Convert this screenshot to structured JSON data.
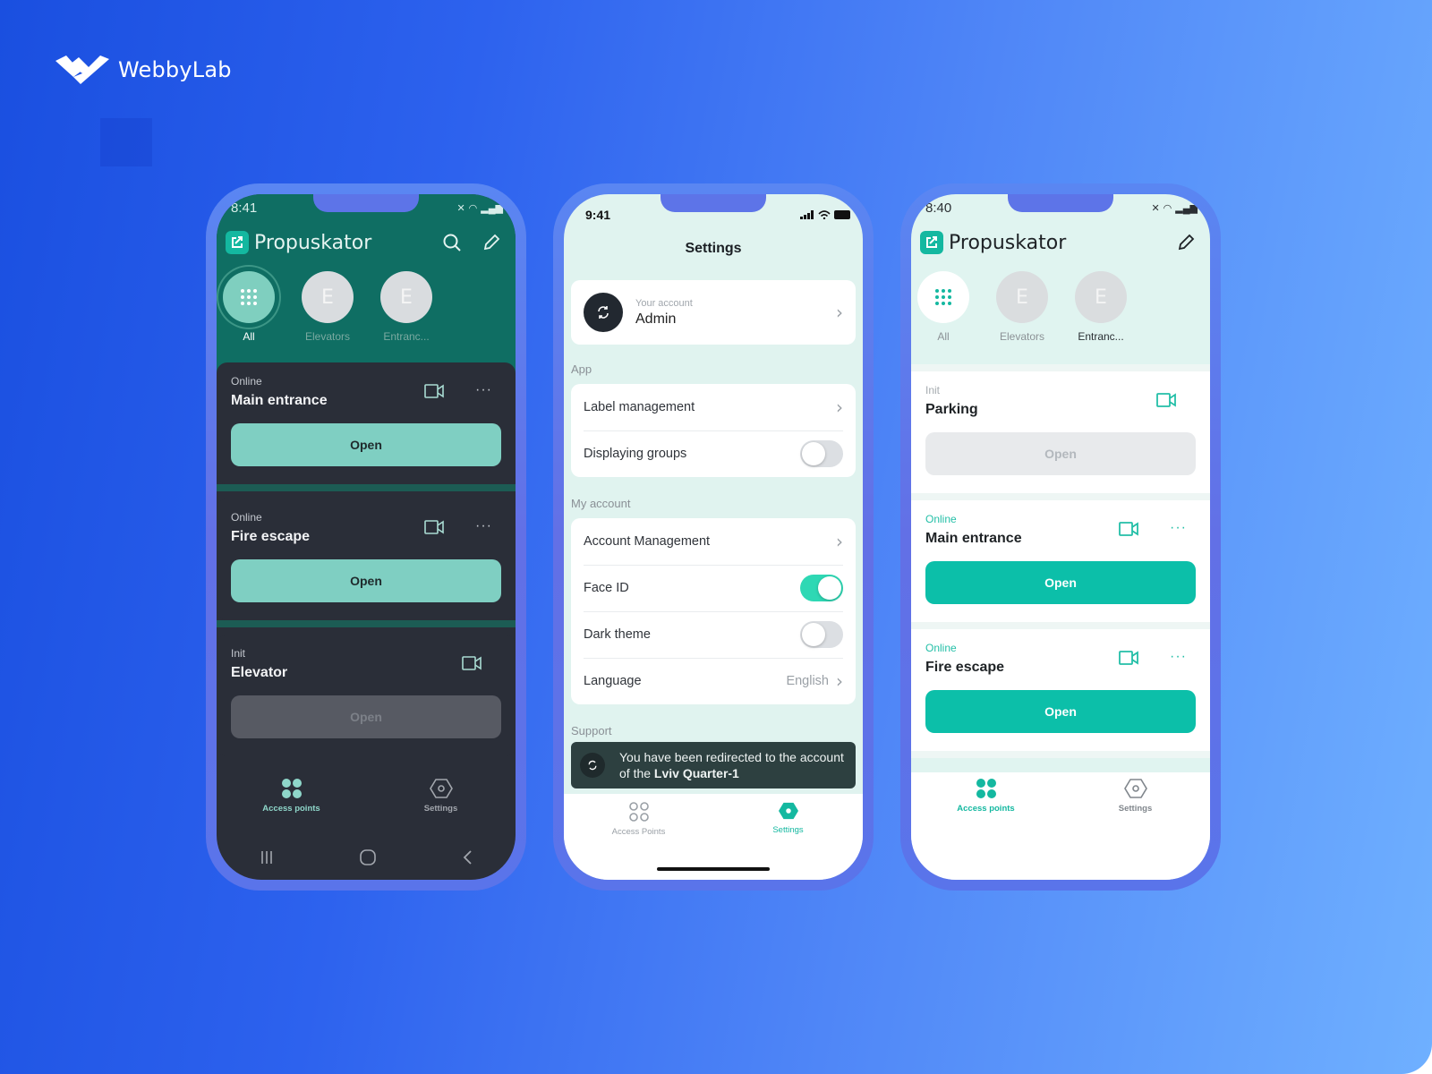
{
  "brand": {
    "name": "WebbyLab"
  },
  "colors": {
    "accent": "#14b8a0",
    "dark_bg": "#2a2e38",
    "dark_header": "#0f6e63",
    "light_bg": "#e0f4f0",
    "toggle_on": "#2ed8b4"
  },
  "phone_dark": {
    "status_time": "8:41",
    "app_title": "Propuskator",
    "groups": [
      {
        "label": "All",
        "icon": "grid-icon",
        "active": true
      },
      {
        "label": "Elevators",
        "initial": "E"
      },
      {
        "label": "Entranc...",
        "initial": "E"
      }
    ],
    "cards": [
      {
        "status": "Online",
        "name": "Main entrance",
        "button": "Open",
        "enabled": true,
        "has_more": true
      },
      {
        "status": "Online",
        "name": "Fire escape",
        "button": "Open",
        "enabled": true,
        "has_more": true
      },
      {
        "status": "Init",
        "name": "Elevator",
        "button": "Open",
        "enabled": false,
        "has_more": false
      }
    ],
    "tabs": [
      {
        "label": "Access points",
        "active": true
      },
      {
        "label": "Settings"
      }
    ]
  },
  "phone_settings": {
    "status_time": "9:41",
    "title": "Settings",
    "account": {
      "sub": "Your account",
      "name": "Admin"
    },
    "sections": {
      "app": "App",
      "my_account": "My account",
      "support": "Support"
    },
    "rows": {
      "label_management": "Label management",
      "displaying_groups": "Displaying groups",
      "account_management": "Account Management",
      "face_id": "Face ID",
      "dark_theme": "Dark theme",
      "language": "Language",
      "language_value": "English"
    },
    "toggles": {
      "displaying_groups": false,
      "face_id": true,
      "dark_theme": false
    },
    "toast": {
      "text": "You have been redirected to the account of the ",
      "bold": "Lviv Quarter-1"
    },
    "tabs": [
      {
        "label": "Access Points"
      },
      {
        "label": "Settings",
        "active": true
      }
    ]
  },
  "phone_light": {
    "status_time": "8:40",
    "app_title": "Propuskator",
    "groups": [
      {
        "label": "All",
        "icon": "grid-icon",
        "active": true
      },
      {
        "label": "Elevators",
        "initial": "E"
      },
      {
        "label": "Entranc...",
        "initial": "E"
      }
    ],
    "cards": [
      {
        "status": "Init",
        "name": "Parking",
        "button": "Open",
        "enabled": false,
        "has_more": false
      },
      {
        "status": "Online",
        "name": "Main entrance",
        "button": "Open",
        "enabled": true,
        "has_more": true
      },
      {
        "status": "Online",
        "name": "Fire escape",
        "button": "Open",
        "enabled": true,
        "has_more": true
      }
    ],
    "tabs": [
      {
        "label": "Access points",
        "active": true
      },
      {
        "label": "Settings"
      }
    ]
  },
  "glyphs": {
    "more": "···",
    "chevron": "›"
  }
}
